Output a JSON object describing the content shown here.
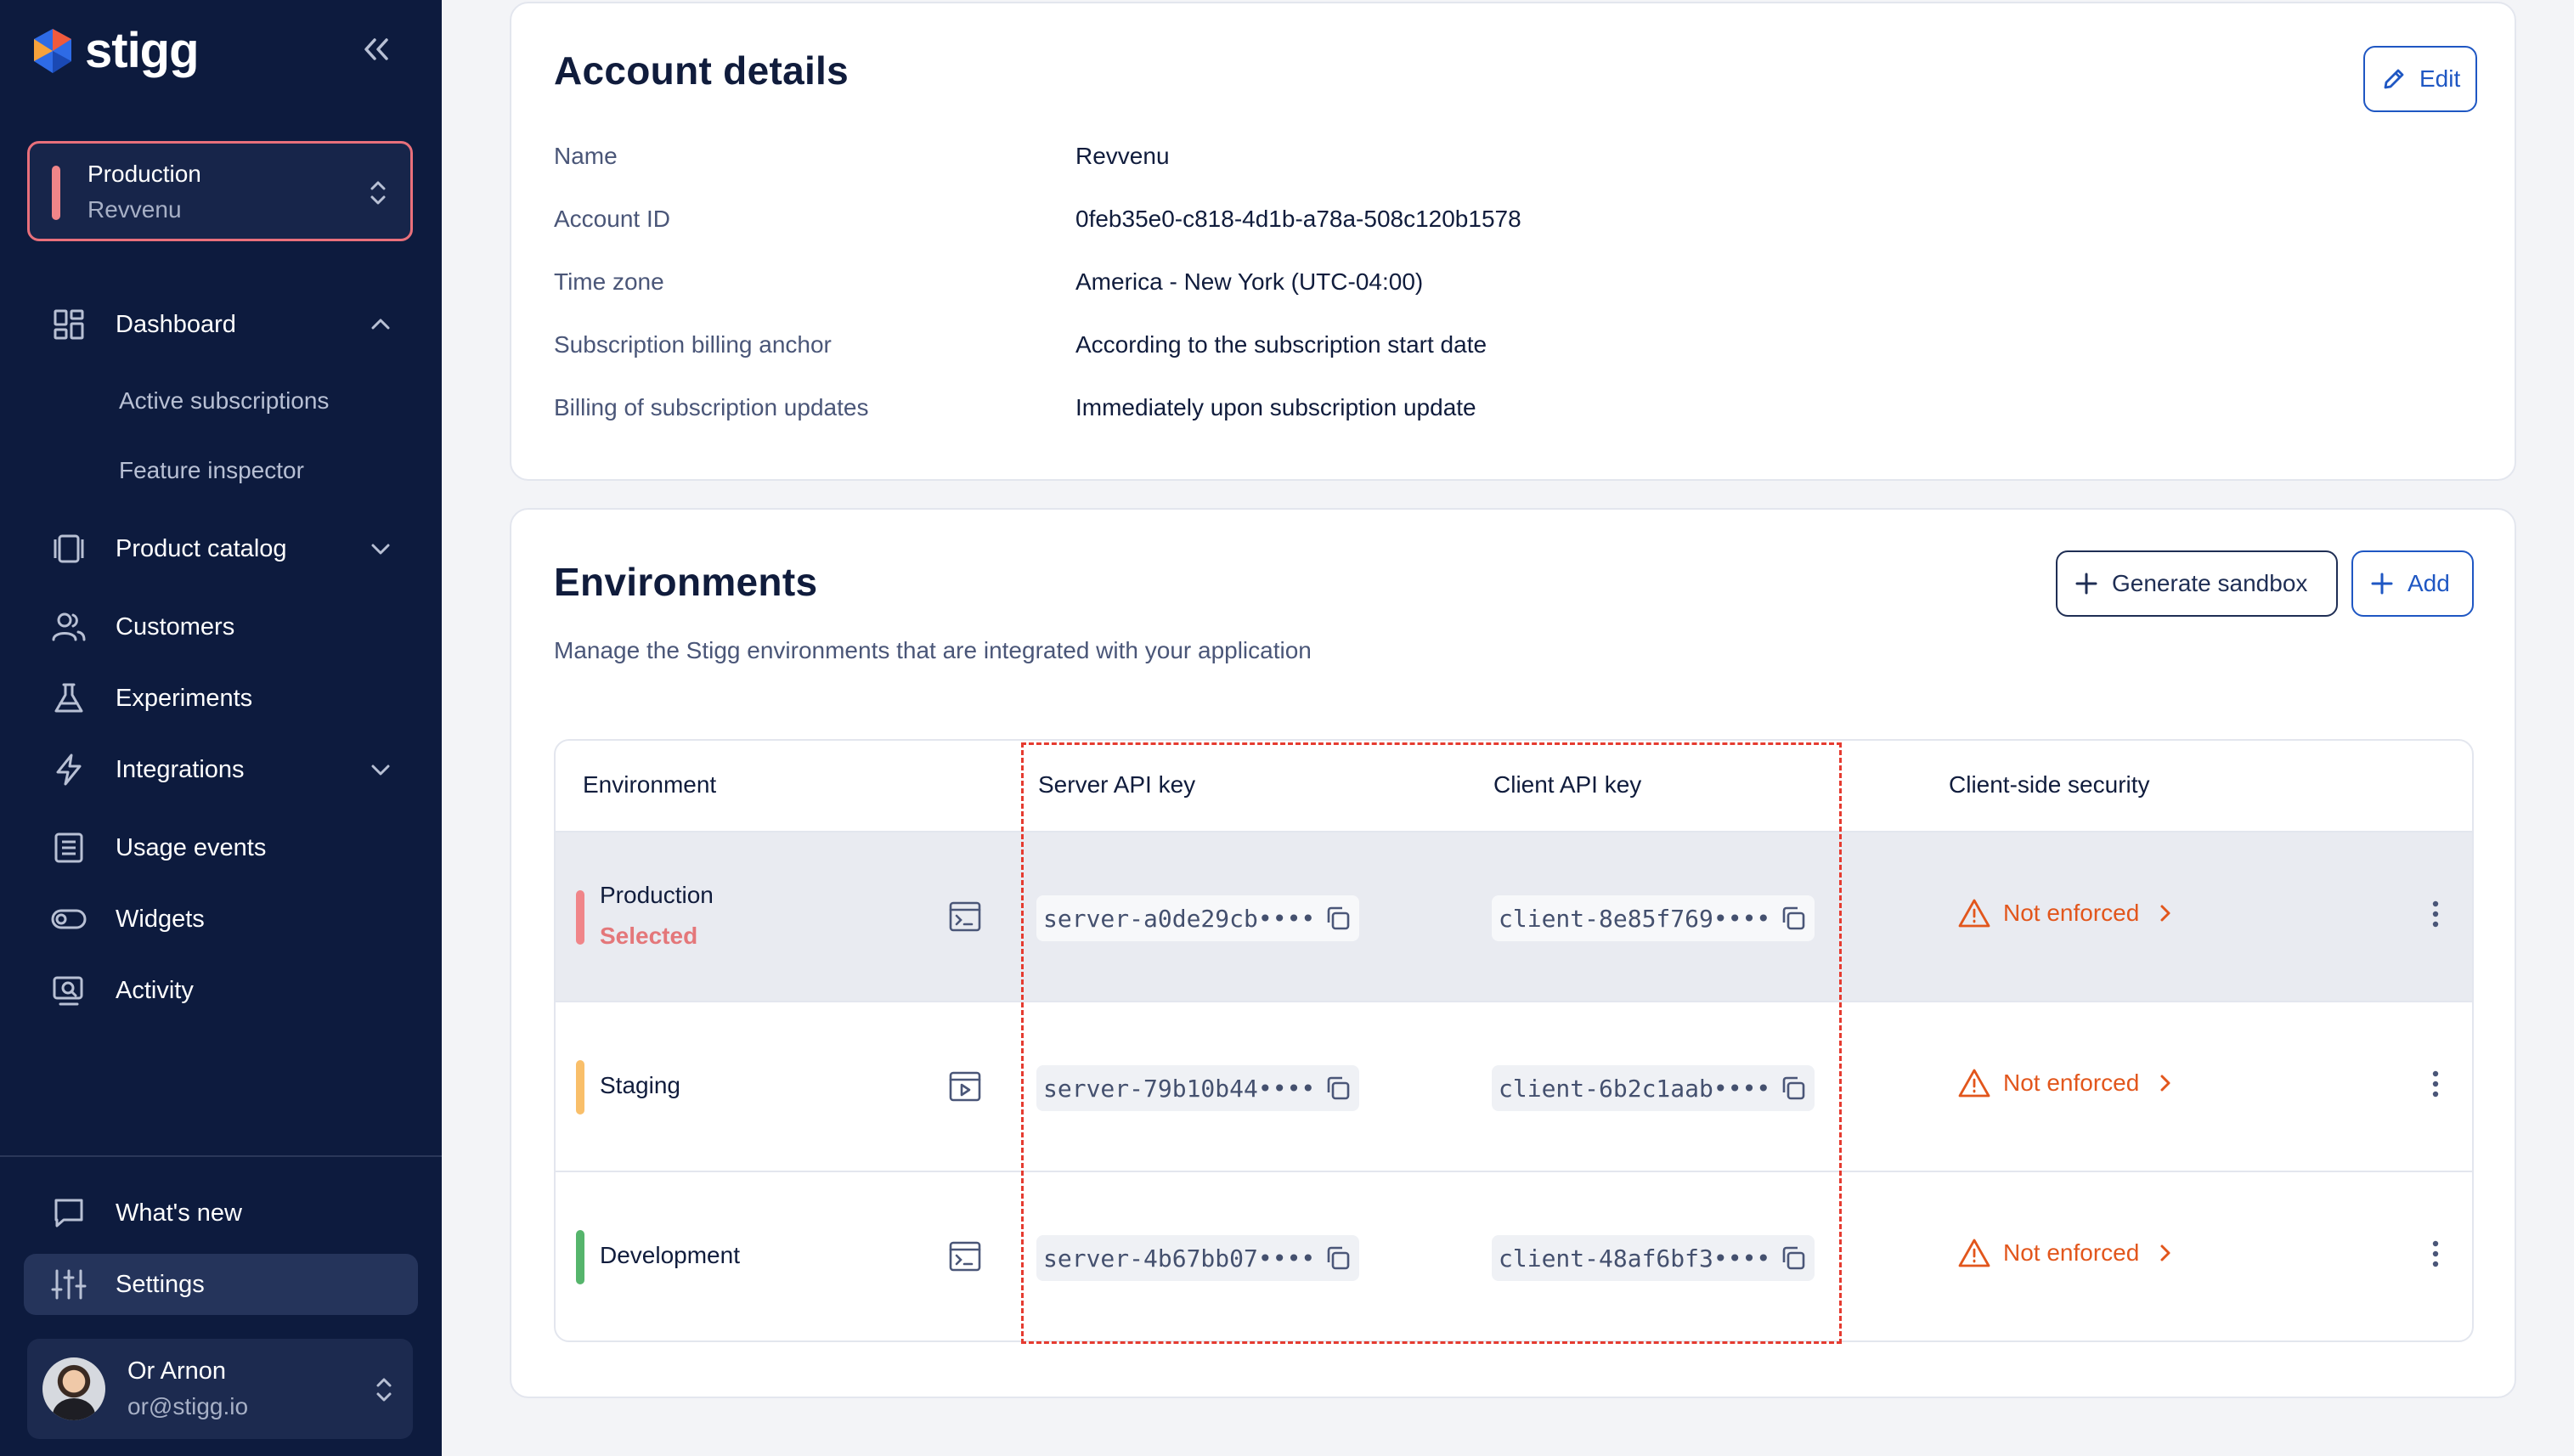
{
  "brand": {
    "name": "stigg"
  },
  "sidebar": {
    "env_switcher": {
      "name": "Production",
      "account": "Revvenu",
      "color": "#f08589"
    },
    "nav": [
      {
        "label": "Dashboard",
        "icon": "dashboard-icon",
        "expanded": true
      },
      {
        "label": "Product catalog",
        "icon": "catalog-icon",
        "expanded": false
      },
      {
        "label": "Customers",
        "icon": "customers-icon"
      },
      {
        "label": "Experiments",
        "icon": "flask-icon"
      },
      {
        "label": "Integrations",
        "icon": "bolt-icon",
        "expanded": false
      },
      {
        "label": "Usage events",
        "icon": "list-icon"
      },
      {
        "label": "Widgets",
        "icon": "toggle-icon"
      },
      {
        "label": "Activity",
        "icon": "activity-icon"
      }
    ],
    "dashboard_sub": [
      "Active subscriptions",
      "Feature inspector"
    ],
    "bottom": [
      {
        "label": "What's new",
        "icon": "chat-icon"
      },
      {
        "label": "Settings",
        "icon": "sliders-icon",
        "active": true
      }
    ],
    "user": {
      "name": "Or Arnon",
      "email": "or@stigg.io"
    }
  },
  "account": {
    "title": "Account details",
    "edit_label": "Edit",
    "fields": [
      {
        "label": "Name",
        "value": "Revvenu"
      },
      {
        "label": "Account ID",
        "value": "0feb35e0-c818-4d1b-a78a-508c120b1578"
      },
      {
        "label": "Time zone",
        "value": "America - New York (UTC-04:00)"
      },
      {
        "label": "Subscription billing anchor",
        "value": "According to the subscription start date"
      },
      {
        "label": "Billing of subscription updates",
        "value": "Immediately upon subscription update"
      }
    ]
  },
  "environments": {
    "title": "Environments",
    "description": "Manage the Stigg environments that are integrated with your application",
    "generate_label": "Generate sandbox",
    "add_label": "Add",
    "columns": [
      "Environment",
      "Server API key",
      "Client API key",
      "Client-side security"
    ],
    "rows": [
      {
        "name": "Production",
        "badge": "Selected",
        "color": "#f08589",
        "server_key": "server-a0de29cb••••",
        "client_key": "client-8e85f769••••",
        "security": "Not enforced"
      },
      {
        "name": "Staging",
        "badge": "",
        "color": "#f9bf6a",
        "server_key": "server-79b10b44••••",
        "client_key": "client-6b2c1aab••••",
        "security": "Not enforced"
      },
      {
        "name": "Development",
        "badge": "",
        "color": "#56b56c",
        "server_key": "server-4b67bb07••••",
        "client_key": "client-48af6bf3••••",
        "security": "Not enforced"
      }
    ]
  },
  "colors": {
    "sidebar_bg": "#0d1b3e",
    "accent": "#1f57c3",
    "warning": "#e2561c",
    "highlight_box": "#e53b30"
  }
}
